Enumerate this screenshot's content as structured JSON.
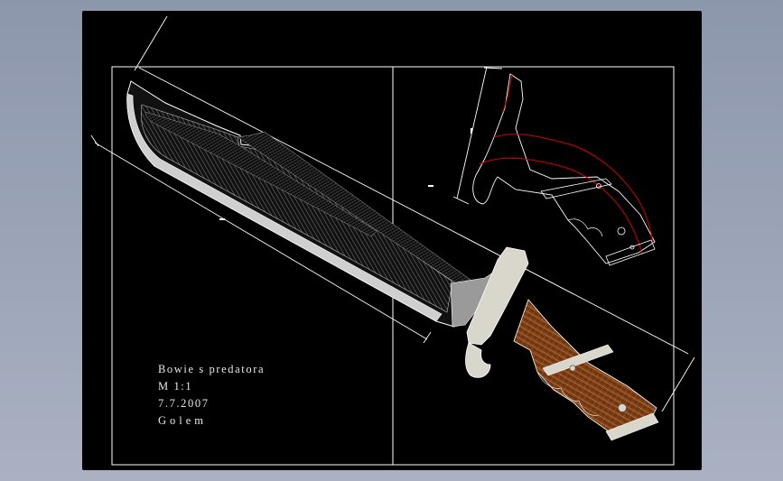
{
  "drawing": {
    "title": "Bowie s predatora",
    "scale": "M 1:1",
    "date": "7.7.2007",
    "author": "Golem"
  },
  "colors": {
    "background": "#000000",
    "lines": "#ffffff",
    "guard": "#d9d6cc",
    "handle": "#8a4a1e",
    "handle_hatch": "#c0793a",
    "handle_section": "#d40000"
  }
}
